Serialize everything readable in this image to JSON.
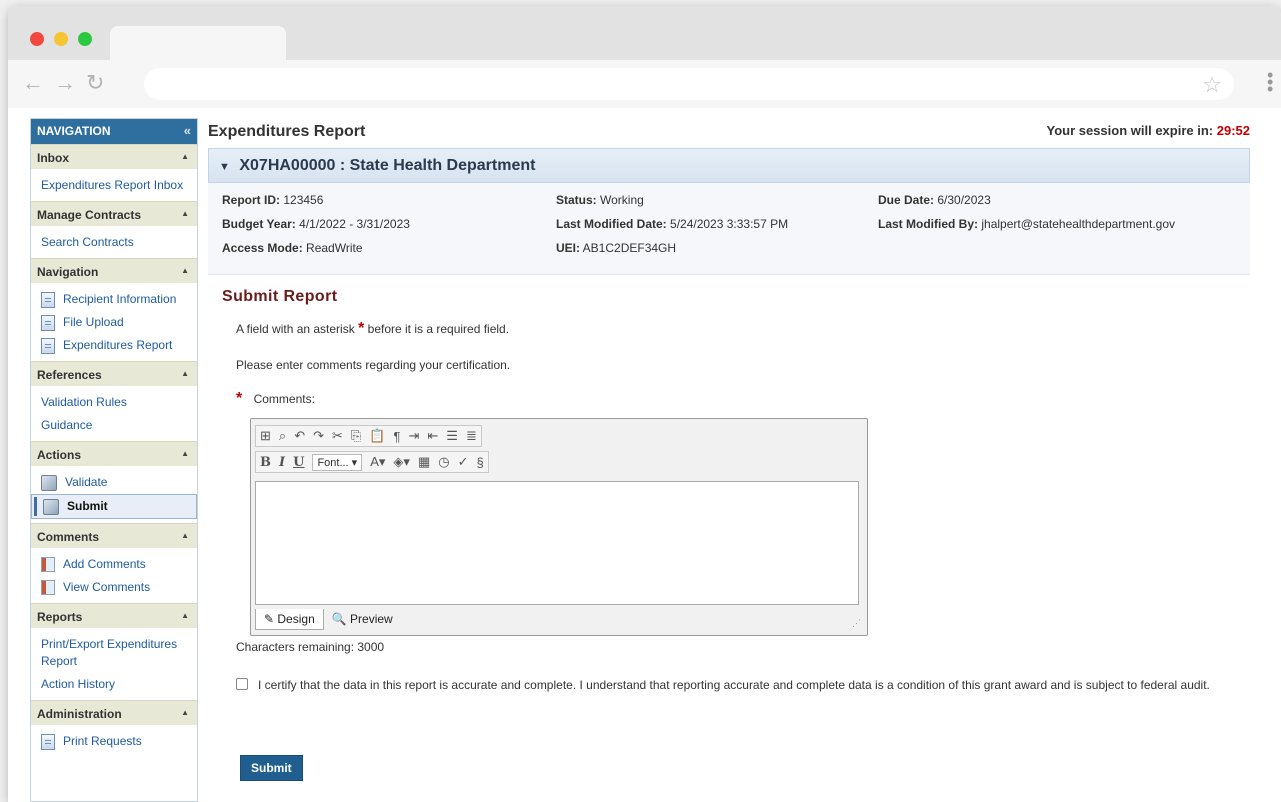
{
  "browser": {},
  "navigation": {
    "header": "NAVIGATION",
    "collapse_glyph": "«",
    "sections": [
      {
        "title": "Inbox",
        "items": [
          "Expenditures Report Inbox"
        ]
      },
      {
        "title": "Manage Contracts",
        "items": [
          "Search Contracts"
        ]
      },
      {
        "title": "Navigation",
        "items": [
          "Recipient Information",
          "File Upload",
          "Expenditures Report"
        ]
      },
      {
        "title": "References",
        "items": [
          "Validation Rules",
          "Guidance"
        ]
      },
      {
        "title": "Actions",
        "items": [
          "Validate",
          "Submit"
        ]
      },
      {
        "title": "Comments",
        "items": [
          "Add Comments",
          "View Comments"
        ]
      },
      {
        "title": "Reports",
        "items": [
          "Print/Export Expenditures Report",
          "Action History"
        ]
      },
      {
        "title": "Administration",
        "items": [
          "Print Requests"
        ]
      }
    ]
  },
  "header": {
    "title": "Expenditures Report",
    "session_label": "Your session will expire in:",
    "session_time": "29:52"
  },
  "contract": {
    "title": "X07HA00000 : State Health Department"
  },
  "report_info": {
    "report_id_label": "Report ID:",
    "report_id": "123456",
    "status_label": "Status:",
    "status": "Working",
    "due_date_label": "Due Date:",
    "due_date": "6/30/2023",
    "budget_year_label": "Budget Year:",
    "budget_year": "4/1/2022 - 3/31/2023",
    "last_modified_date_label": "Last Modified Date:",
    "last_modified_date": "5/24/2023 3:33:57 PM",
    "last_modified_by_label": "Last Modified By:",
    "last_modified_by": "jhalpert@statehealthdepartment.gov",
    "access_mode_label": "Access Mode:",
    "access_mode": "ReadWrite",
    "uei_label": "UEI:",
    "uei": "AB1C2DEF34GH"
  },
  "submit_section": {
    "title": "Submit Report",
    "required_note_pre": "A field with an asterisk",
    "required_note_post": "before it is a required field.",
    "asterisk": "*",
    "instructions": "Please enter comments regarding your certification.",
    "comments_label": "Comments:",
    "editor": {
      "font_select": "Font...",
      "design_tab": "Design",
      "preview_tab": "Preview"
    },
    "chars_remaining": "Characters remaining: 3000",
    "certify_text": "I certify that the data in this report is accurate and complete. I understand that reporting accurate and complete data is a condition of this grant award and is subject to federal audit.",
    "submit_label": "Submit"
  }
}
